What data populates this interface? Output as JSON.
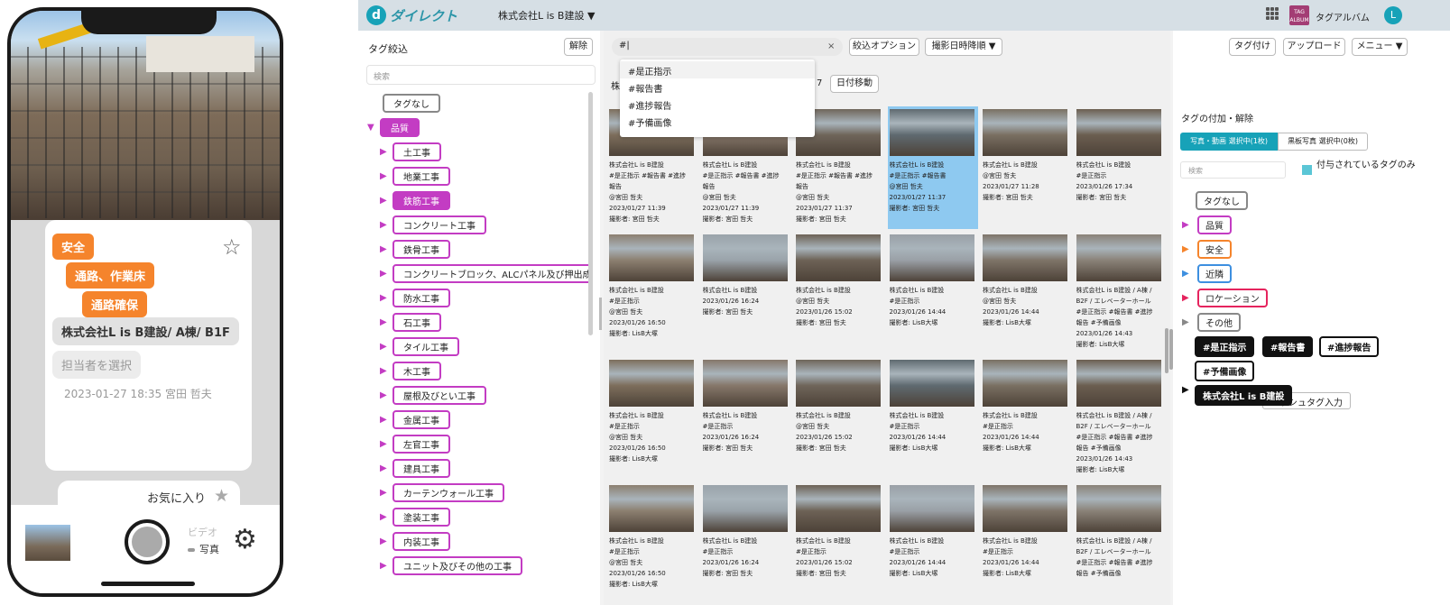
{
  "mobile": {
    "card": {
      "tags": [
        "安全",
        "通路、作業床",
        "通路確保"
      ],
      "project": "株式会社L is B建設/ A棟/ B1F",
      "assignee_placeholder": "担当者を選択",
      "datetime": "2023-01-27 18:35 宮田 哲夫"
    },
    "favorite_label": "お気に入り",
    "mode_video": "ビデオ",
    "mode_photo": "写真"
  },
  "web": {
    "logo_text": "ダイレクト",
    "logo_mark": "d",
    "company_selector": "株式会社L is B建設 ▼",
    "tag_album_logo": "TAG ALBUM",
    "tag_album_label": "タグアルバム",
    "user_initial": "L",
    "left_panel": {
      "title": "タグ絞込",
      "clear_button": "解除",
      "search_placeholder": "検索",
      "none_tag": "タグなし",
      "root_tag": "品質",
      "children": [
        "土工事",
        "地業工事",
        "鉄筋工事",
        "コンクリート工事",
        "鉄骨工事",
        "コンクリートブロック、ALCパネル及び押出成形",
        "防水工事",
        "石工事",
        "タイル工事",
        "木工事",
        "屋根及びとい工事",
        "金属工事",
        "左官工事",
        "建具工事",
        "カーテンウォール工事",
        "塗装工事",
        "内装工事",
        "ユニット及びその他の工事"
      ],
      "selected_child": "鉄筋工事"
    },
    "toolbar": {
      "search_value": "#|",
      "clear_icon": "×",
      "filter_options": "絞込オプション",
      "sort": "撮影日時降順 ▼",
      "tag_button": "タグ付け",
      "upload_button": "アップロード",
      "menu_button": "メニュー ▼",
      "date_prefix": "株",
      "date_suffix": "7",
      "date_move": "日付移動"
    },
    "suggestions": [
      "#是正指示",
      "#報告書",
      "#進捗報告",
      "#予備画像"
    ],
    "photos": [
      {
        "caption": [
          "株式会社L is B建設",
          "#是正指示 #報告書 #進捗",
          "報告",
          "@宮田 哲夫",
          "2023/01/27 11:39",
          "撮影者: 宮田 哲夫"
        ],
        "selected": false
      },
      {
        "caption": [
          "株式会社L is B建設",
          "#是正指示 #報告書 #進捗",
          "報告",
          "@宮田 哲夫",
          "2023/01/27 11:39",
          "撮影者: 宮田 哲夫"
        ],
        "selected": false
      },
      {
        "caption": [
          "株式会社L is B建設",
          "#是正指示 #報告書 #進捗",
          "報告",
          "@宮田 哲夫",
          "2023/01/27 11:37",
          "撮影者: 宮田 哲夫"
        ],
        "selected": false
      },
      {
        "caption": [
          "株式会社L is B建設",
          "#是正指示 #報告書",
          "@宮田 哲夫",
          "2023/01/27 11:37",
          "撮影者: 宮田 哲夫"
        ],
        "selected": true
      },
      {
        "caption": [
          "株式会社L is B建設",
          "@宮田 哲夫",
          "2023/01/27 11:28",
          "撮影者: 宮田 哲夫"
        ],
        "selected": false
      },
      {
        "caption": [
          "株式会社L is B建設",
          "#是正指示",
          "2023/01/26 17:34",
          "撮影者: 宮田 哲夫"
        ],
        "selected": false
      },
      {
        "caption": [
          "株式会社L is B建設",
          "#是正指示",
          "@宮田 哲夫",
          "2023/01/26 16:50",
          "撮影者: LisB大塚"
        ],
        "selected": false
      },
      {
        "caption": [
          "株式会社L is B建設",
          "2023/01/26 16:24",
          "撮影者: 宮田 哲夫"
        ],
        "selected": false
      },
      {
        "caption": [
          "株式会社L is B建設",
          "@宮田 哲夫",
          "2023/01/26 15:02",
          "撮影者: 宮田 哲夫"
        ],
        "selected": false
      },
      {
        "caption": [
          "株式会社L is B建設",
          "#是正指示",
          "2023/01/26 14:44",
          "撮影者: LisB大塚"
        ],
        "selected": false
      },
      {
        "caption": [
          "株式会社L is B建設",
          "@宮田 哲夫",
          "2023/01/26 14:44",
          "撮影者: LisB大塚"
        ],
        "selected": false
      },
      {
        "caption": [
          "株式会社L is B建設 / A棟 /",
          "B2F / エレベーターホール",
          "#是正指示 #報告書 #進捗",
          "報告 #予備画像",
          "2023/01/26 14:43",
          "撮影者: LisB大塚"
        ],
        "selected": false
      },
      {
        "caption": [
          "株式会社L is B建設",
          "#是正指示",
          "@宮田 哲夫",
          "2023/01/26 16:50",
          "撮影者: LisB大塚"
        ],
        "selected": false
      },
      {
        "caption": [
          "株式会社L is B建設",
          "#是正指示",
          "2023/01/26 16:24",
          "撮影者: 宮田 哲夫"
        ],
        "selected": false
      },
      {
        "caption": [
          "株式会社L is B建設",
          "@宮田 哲夫",
          "2023/01/26 15:02",
          "撮影者: 宮田 哲夫"
        ],
        "selected": false
      },
      {
        "caption": [
          "株式会社L is B建設",
          "#是正指示",
          "2023/01/26 14:44",
          "撮影者: LisB大塚"
        ],
        "selected": false
      },
      {
        "caption": [
          "株式会社L is B建設",
          "#是正指示",
          "2023/01/26 14:44",
          "撮影者: LisB大塚"
        ],
        "selected": false
      },
      {
        "caption": [
          "株式会社L is B建設 / A棟 /",
          "B2F / エレベーターホール",
          "#是正指示 #報告書 #進捗",
          "報告 #予備画像",
          "2023/01/26 14:43",
          "撮影者: LisB大塚"
        ],
        "selected": false
      },
      {
        "caption": [
          "株式会社L is B建設",
          "#是正指示",
          "@宮田 哲夫",
          "2023/01/26 16:50",
          "撮影者: LisB大塚"
        ],
        "selected": false
      },
      {
        "caption": [
          "株式会社L is B建設",
          "#是正指示",
          "2023/01/26 16:24",
          "撮影者: 宮田 哲夫"
        ],
        "selected": false
      },
      {
        "caption": [
          "株式会社L is B建設",
          "#是正指示",
          "2023/01/26 15:02",
          "撮影者: 宮田 哲夫"
        ],
        "selected": false
      },
      {
        "caption": [
          "株式会社L is B建設",
          "#是正指示",
          "2023/01/26 14:44",
          "撮影者: LisB大塚"
        ],
        "selected": false
      },
      {
        "caption": [
          "株式会社L is B建設",
          "#是正指示",
          "2023/01/26 14:44",
          "撮影者: LisB大塚"
        ],
        "selected": false
      },
      {
        "caption": [
          "株式会社L is B建設 / A棟 /",
          "B2F / エレベーターホール",
          "#是正指示 #報告書 #進捗",
          "報告 #予備画像"
        ],
        "selected": false
      }
    ],
    "right_panel": {
      "title": "タグの付加・解除",
      "seg_photos": "写真・動画 選択中(1枚)",
      "seg_board": "黒板写真 選択中(0枚)",
      "search_placeholder": "検索",
      "only_assigned": "付与されているタグのみ",
      "none_tag": "タグなし",
      "categories": [
        {
          "label": "品質",
          "color": "#c33cc3"
        },
        {
          "label": "安全",
          "color": "#f5842c"
        },
        {
          "label": "近隣",
          "color": "#3d8fe0"
        },
        {
          "label": "ロケーション",
          "color": "#e5245e"
        },
        {
          "label": "その他",
          "color": "#888888"
        }
      ],
      "hashtags_filled": [
        "#是正指示",
        "#報告書"
      ],
      "hashtags_outlined": [
        "#進捗報告",
        "#予備画像"
      ],
      "hashtag_input": "ハッシュタグ入力",
      "project_tag": "株式会社L is B建設"
    }
  }
}
